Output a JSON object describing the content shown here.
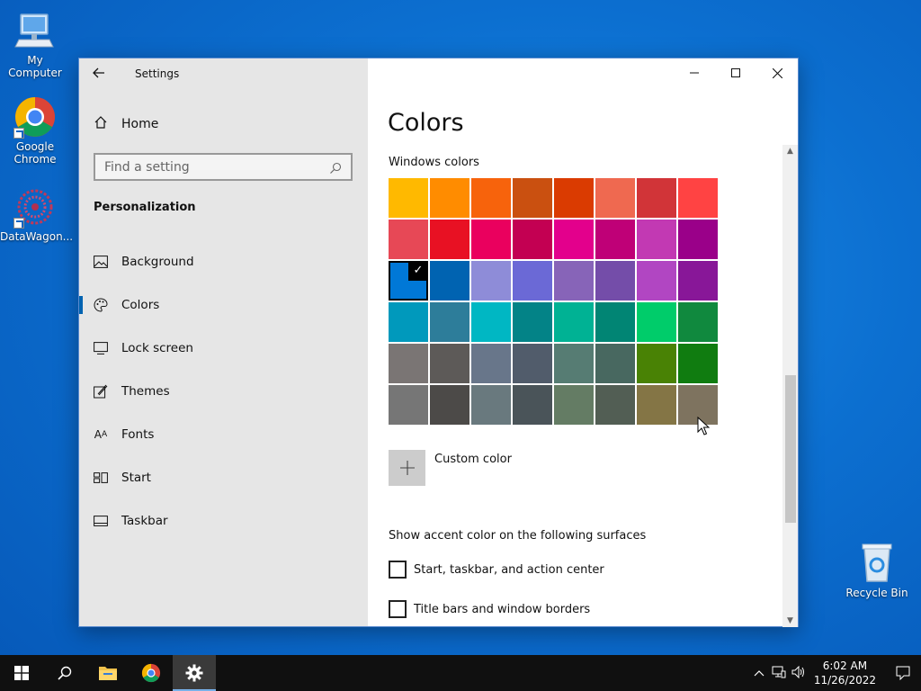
{
  "desktop": {
    "icons": [
      {
        "label": "My Computer"
      },
      {
        "label": "Google Chrome"
      },
      {
        "label": "DataWagon..."
      },
      {
        "label": "Recycle Bin"
      }
    ]
  },
  "window": {
    "title": "Settings",
    "home_label": "Home",
    "search_placeholder": "Find a setting",
    "section": "Personalization",
    "nav": [
      {
        "label": "Background",
        "icon": "image-icon"
      },
      {
        "label": "Colors",
        "icon": "palette-icon"
      },
      {
        "label": "Lock screen",
        "icon": "lock-screen-icon"
      },
      {
        "label": "Themes",
        "icon": "themes-icon"
      },
      {
        "label": "Fonts",
        "icon": "fonts-icon"
      },
      {
        "label": "Start",
        "icon": "start-icon"
      },
      {
        "label": "Taskbar",
        "icon": "taskbar-icon"
      }
    ],
    "selected_nav": "Colors"
  },
  "content": {
    "page_title": "Colors",
    "windows_colors_label": "Windows colors",
    "swatches": [
      "#FFB900",
      "#FF8C00",
      "#F7630C",
      "#CA5010",
      "#DA3B01",
      "#EF6950",
      "#D13438",
      "#FF4343",
      "#E74856",
      "#E81123",
      "#EA005E",
      "#C30052",
      "#E3008C",
      "#BF0077",
      "#C239B3",
      "#9A0089",
      "#0078D7",
      "#0063B1",
      "#8E8CD8",
      "#6B69D6",
      "#8764B8",
      "#744DA9",
      "#B146C2",
      "#881798",
      "#0099BC",
      "#2D7D9A",
      "#00B7C3",
      "#038387",
      "#00B294",
      "#018574",
      "#00CC6A",
      "#10893E",
      "#7A7574",
      "#5D5A58",
      "#68768A",
      "#515C6B",
      "#567C73",
      "#486860",
      "#498205",
      "#107C10",
      "#767676",
      "#4C4A48",
      "#69797E",
      "#4A5459",
      "#647C64",
      "#525E54",
      "#847545",
      "#7E735F"
    ],
    "selected_swatch": 16,
    "custom_color_label": "Custom color",
    "accent_label": "Show accent color on the following surfaces",
    "checkboxes": [
      {
        "label": "Start, taskbar, and action center",
        "checked": false
      },
      {
        "label": "Title bars and window borders",
        "checked": false
      }
    ]
  },
  "taskbar": {
    "time": "6:02 AM",
    "date": "11/26/2022"
  },
  "colors": {
    "accent": "#0063B1",
    "sidebar_bg": "#E6E6E6",
    "taskbar_bg": "#101010"
  }
}
